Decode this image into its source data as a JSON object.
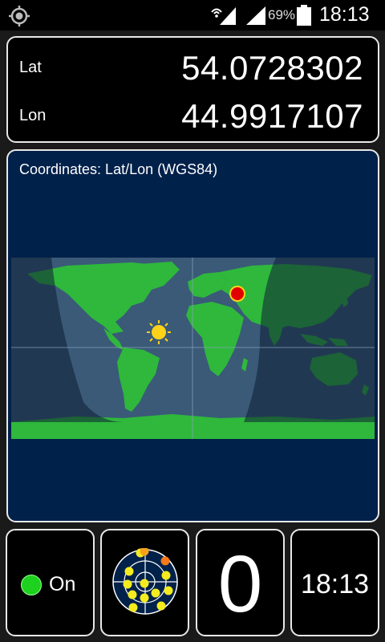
{
  "status_bar": {
    "battery_percent": "69%",
    "clock": "18:13",
    "icons": [
      "gps-icon",
      "wifi-signal-icon",
      "cell-signal-icon",
      "battery-icon"
    ]
  },
  "coordinates": {
    "lat_label": "Lat",
    "lat_value": "54.0728302",
    "lon_label": "Lon",
    "lon_value": "44.9917107"
  },
  "map": {
    "title": "Coordinates: Lat/Lon (WGS84)",
    "colors": {
      "land": "#2fb83c",
      "ocean": "#3a5a78",
      "night": "#1a2f4a",
      "marker": "#e00000",
      "sun": "#ffd21a"
    }
  },
  "bottom": {
    "status_label": "On",
    "status_color": "#1fd11f",
    "satellites_in_fix": "0",
    "time": "18:13"
  }
}
